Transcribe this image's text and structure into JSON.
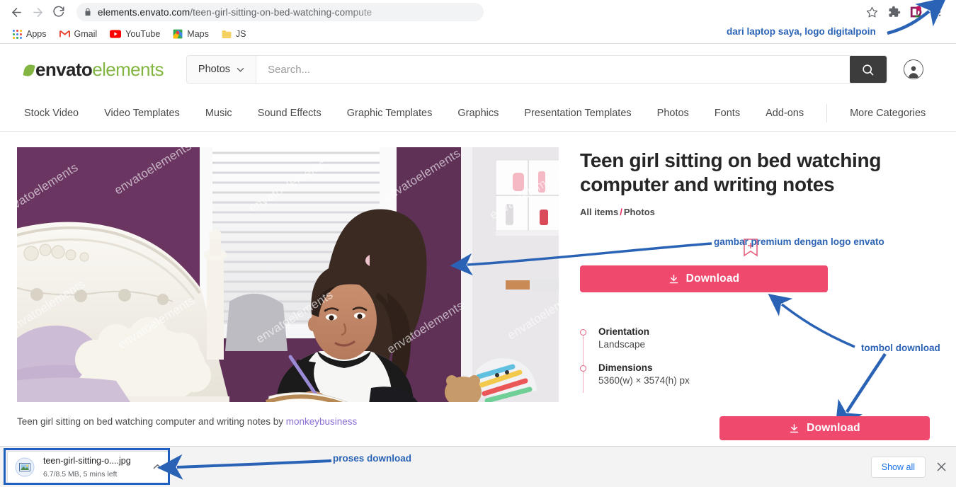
{
  "browser": {
    "back_icon": "back-arrow-icon",
    "forward_icon": "forward-arrow-icon",
    "reload_icon": "reload-icon",
    "lock_icon": "lock-icon",
    "url_host": "elements.envato.com",
    "url_path": "/teen-girl-sitting-on-bed-watching-compute",
    "star_icon": "bookmark-star-icon",
    "extension_icon": "extension-puzzle-icon",
    "digitalpoin_icon": "digitalpoin-extension-icon",
    "menu_icon": "three-dot-menu-icon",
    "bookmarks": [
      {
        "label": "Apps",
        "icon": "apps-grid-icon"
      },
      {
        "label": "Gmail",
        "icon": "gmail-icon"
      },
      {
        "label": "YouTube",
        "icon": "youtube-icon"
      },
      {
        "label": "Maps",
        "icon": "google-maps-icon"
      },
      {
        "label": "JS",
        "icon": "folder-icon"
      }
    ]
  },
  "site": {
    "logo": {
      "brand": "envato",
      "product": "elements",
      "leaf_icon": "envato-leaf-icon"
    },
    "search": {
      "category": "Photos",
      "category_caret": "chevron-down-icon",
      "placeholder": "Search...",
      "value": "",
      "button_icon": "search-icon"
    },
    "account_icon": "user-avatar-icon",
    "nav": [
      "Stock Video",
      "Video Templates",
      "Music",
      "Sound Effects",
      "Graphic Templates",
      "Graphics",
      "Presentation Templates",
      "Photos",
      "Fonts",
      "Add-ons"
    ],
    "nav_more": "More Categories"
  },
  "item": {
    "title": "Teen girl sitting on bed watching computer and writing notes",
    "breadcrumb_root": "All items",
    "breadcrumb_sep": "/",
    "breadcrumb_current": "Photos",
    "collect_icon": "add-to-collection-bookmark-icon",
    "download_label": "Download",
    "download_icon": "download-arrow-icon",
    "caption_text": "Teen girl sitting on bed watching computer and writing notes by",
    "caption_author": "monkeybusiness",
    "watermark": "envatoelements",
    "meta": [
      {
        "label": "Orientation",
        "value": "Landscape"
      },
      {
        "label": "Dimensions",
        "value": "5360(w) × 3574(h) px"
      }
    ]
  },
  "shelf": {
    "file_name": "teen-girl-sitting-o....jpg",
    "file_status": "6.7/8.5 MB, 5 mins left",
    "file_icon": "image-file-icon",
    "caret_icon": "chevron-up-icon",
    "show_all_label": "Show all",
    "close_icon": "close-x-icon"
  },
  "annotations": [
    {
      "id": "logo-note",
      "text": "dari laptop saya, logo digitalpoin"
    },
    {
      "id": "image-note",
      "text": "gambar premium dengan logo envato"
    },
    {
      "id": "button-note",
      "text": "tombol download"
    },
    {
      "id": "process-note",
      "text": "proses download"
    }
  ],
  "colors": {
    "envato_green": "#82b541",
    "download_red": "#f0496e",
    "annotation_blue": "#2a63b5",
    "link_purple": "#8c6fd6",
    "chrome_blue": "#1a73e8"
  }
}
